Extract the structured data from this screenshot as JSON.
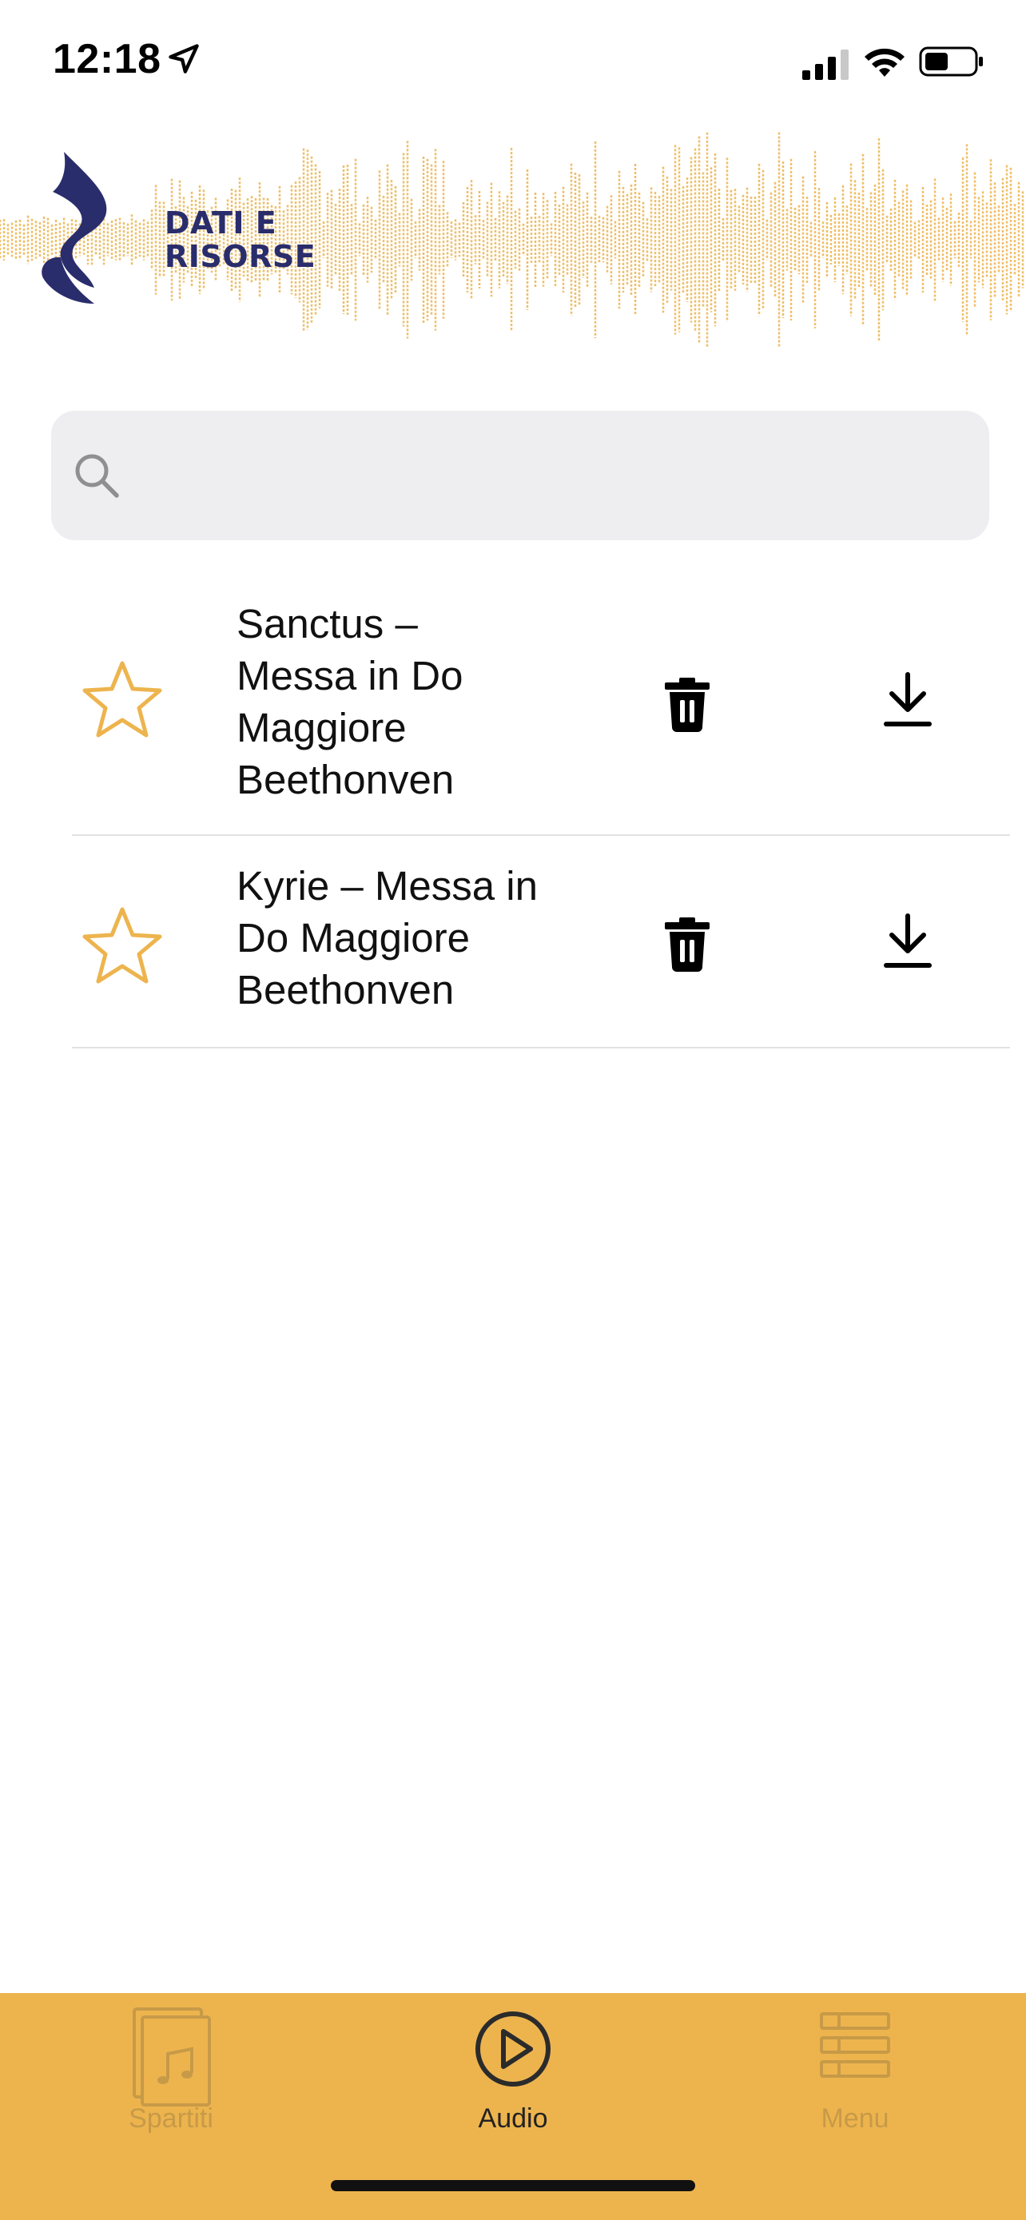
{
  "status_bar": {
    "time": "12:18",
    "icons": [
      "location-arrow-icon",
      "cellular-signal-icon",
      "wifi-icon",
      "battery-icon"
    ]
  },
  "header": {
    "logo_line1": "DATI E",
    "logo_line2": "RISORSE",
    "logo_icon": "music-note-logo-icon",
    "colors": {
      "brand_blue": "#2a2d6b",
      "waveform": "#edb44e"
    }
  },
  "search": {
    "placeholder": "",
    "value": "",
    "icon": "search-icon"
  },
  "audio_list": {
    "items": [
      {
        "title": "Sanctus – Messa in Do Maggiore Beethonven",
        "title_lines": [
          "Sanctus –",
          "Messa in Do",
          "Maggiore",
          "Beethonven"
        ],
        "favorite": false
      },
      {
        "title": "Kyrie – Messa in Do Maggiore Beethonven",
        "title_lines": [
          "Kyrie – Messa in",
          "Do Maggiore",
          "Beethonven"
        ],
        "favorite": false
      }
    ]
  },
  "tab_bar": {
    "background": "#edb44e",
    "tabs": [
      {
        "label": "Spartiti",
        "icon": "sheet-music-icon",
        "active": false
      },
      {
        "label": "Audio",
        "icon": "play-circle-icon",
        "active": true
      },
      {
        "label": "Menu",
        "icon": "menu-list-icon",
        "active": false
      }
    ]
  }
}
